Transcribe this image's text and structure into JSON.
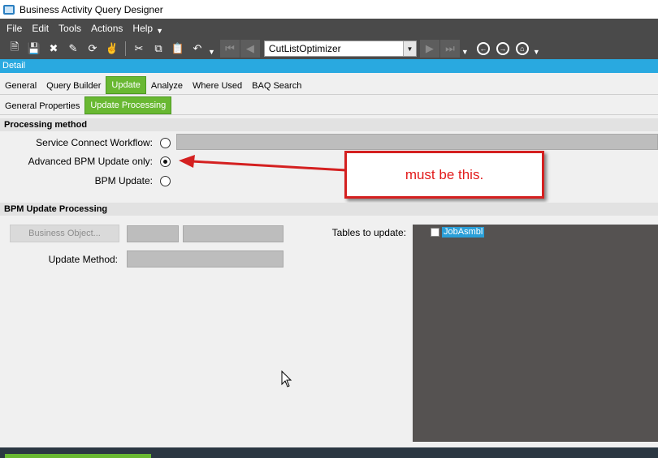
{
  "window": {
    "title": "Business Activity Query Designer"
  },
  "menu": {
    "items": [
      "File",
      "Edit",
      "Tools",
      "Actions",
      "Help"
    ]
  },
  "toolbar": {
    "combo_value": "CutListOptimizer"
  },
  "detail_bar": {
    "label": "Detail"
  },
  "main_tabs": [
    {
      "label": "General",
      "active": false
    },
    {
      "label": "Query Builder",
      "active": false
    },
    {
      "label": "Update",
      "active": true
    },
    {
      "label": "Analyze",
      "active": false
    },
    {
      "label": "Where Used",
      "active": false
    },
    {
      "label": "BAQ Search",
      "active": false
    }
  ],
  "sub_tabs": [
    {
      "label": "General Properties",
      "active": false
    },
    {
      "label": "Update Processing",
      "active": true
    }
  ],
  "processing_method": {
    "header": "Processing method",
    "options": [
      {
        "label": "Service Connect Workflow:",
        "checked": false
      },
      {
        "label": "Advanced BPM Update only:",
        "checked": true
      },
      {
        "label": "BPM Update:",
        "checked": false
      }
    ]
  },
  "bpm_update_processing": {
    "header": "BPM Update Processing",
    "business_object_button": "Business Object...",
    "update_method_label": "Update Method:",
    "tables_label": "Tables to update:",
    "tables": [
      {
        "name": "JobAsmbl",
        "checked": false
      }
    ]
  },
  "annotation": {
    "text": "must be this."
  },
  "colors": {
    "accent_green": "#69b832",
    "detail_blue": "#29a9e0",
    "callout_red": "#d42020",
    "toolbar_dark": "#4a4a4a"
  }
}
